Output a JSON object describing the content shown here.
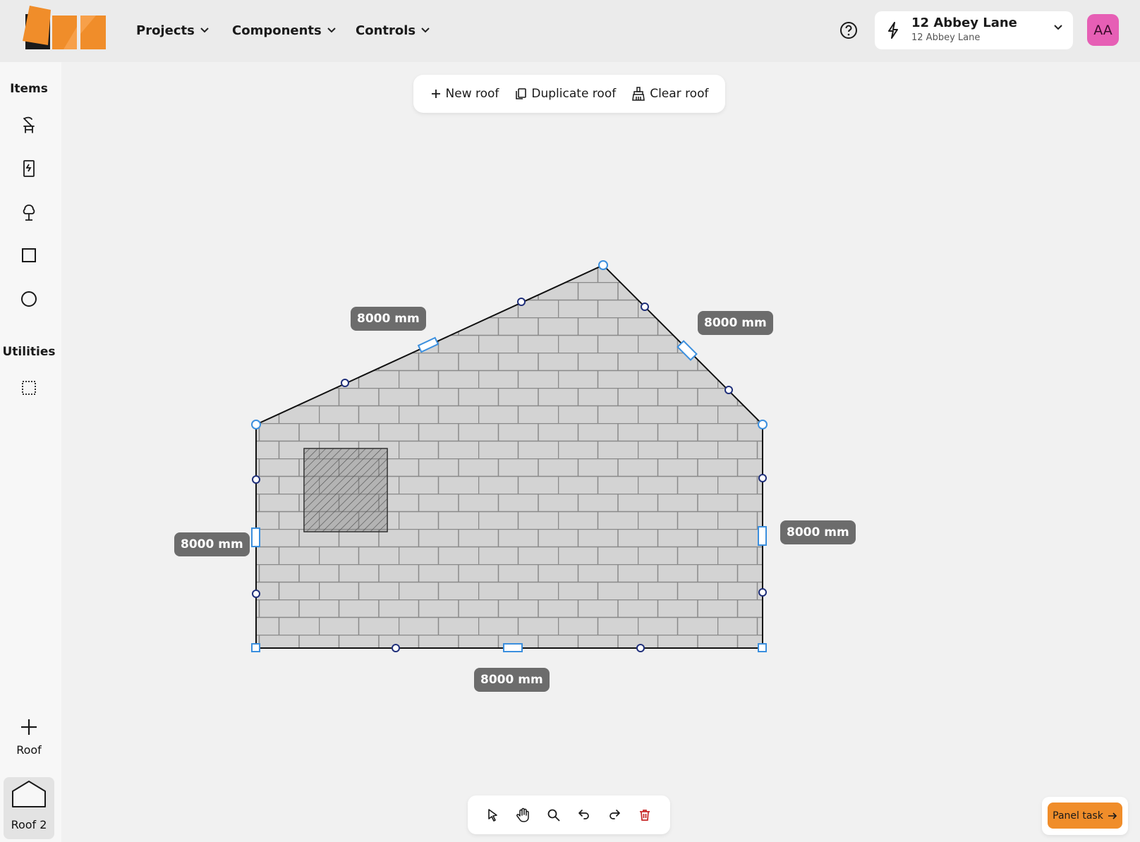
{
  "header": {
    "menus": [
      "Projects",
      "Components",
      "Controls"
    ],
    "project": {
      "title": "12 Abbey Lane",
      "subtitle": "12 Abbey Lane"
    },
    "avatar_initials": "AA"
  },
  "sidebar": {
    "items_heading": "Items",
    "item_icons": [
      "chair-icon",
      "door-icon",
      "tree-icon",
      "square-icon",
      "circle-icon"
    ],
    "utilities_heading": "Utilities",
    "utility_icons": [
      "dotted-select-icon"
    ],
    "add_label": "Roof",
    "roof_tab_label": "Roof 2"
  },
  "roof_toolbar": {
    "new_label": "New roof",
    "duplicate_label": "Duplicate roof",
    "clear_label": "Clear roof"
  },
  "dimensions": {
    "left_slope": "8000 mm",
    "right_slope": "8000 mm",
    "left_wall": "8000 mm",
    "right_wall": "8000 mm",
    "bottom": "8000 mm"
  },
  "bottom_tools": [
    "select-icon",
    "hand-icon",
    "zoom-icon",
    "undo-icon",
    "redo-icon",
    "delete-icon"
  ],
  "panel_task_label": "Panel task",
  "colors": {
    "brand_orange": "#f79a3a",
    "accent_blue": "#3b8fde",
    "avatar_pink": "#e65fb5",
    "brick_fill": "#d3d3d3",
    "delete_red": "#c62828"
  }
}
